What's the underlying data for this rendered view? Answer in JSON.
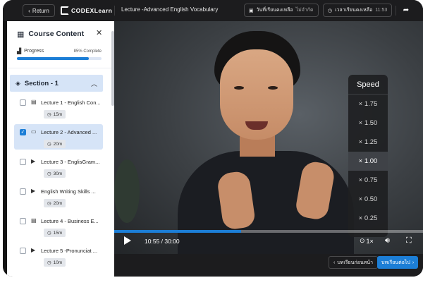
{
  "topbar": {
    "return_label": "Return",
    "logo_text": "CODEXLearn",
    "lecture_title": "Lecture -Advanced English Vocabulary",
    "days_left_label": "วันที่เรียนคงเหลือ",
    "days_left_value": "ไม่จำกัด",
    "time_left_label": "เวลาเรียนคงเหลือ",
    "time_left_value": "11:53"
  },
  "sidebar": {
    "title": "Course Content",
    "progress_label": "Progress",
    "progress_text": "85% Complete",
    "progress_value": 0.85,
    "section_title": "Section - 1",
    "lectures": [
      {
        "title": "Lecture 1 - English Con...",
        "duration": "15m",
        "icon": "document-icon",
        "checked": false,
        "active": false
      },
      {
        "title": "Lecture 2 - Advanced ...",
        "duration": "20m",
        "icon": "folder-icon",
        "checked": true,
        "active": true
      },
      {
        "title": "Lecture 3 - EnglisGram...",
        "duration": "30m",
        "icon": "video-icon",
        "checked": false,
        "active": false
      },
      {
        "title": "English Writing Skills ...",
        "duration": "20m",
        "icon": "video-icon",
        "checked": false,
        "active": false
      },
      {
        "title": "Lecture 4 - Business E...",
        "duration": "15m",
        "icon": "document-icon",
        "checked": false,
        "active": false
      },
      {
        "title": "Lecture 5 -Pronunciat ...",
        "duration": "10m",
        "icon": "video-icon",
        "checked": false,
        "active": false
      }
    ]
  },
  "player": {
    "time_text": "10:55 / 30:00",
    "playback_progress": 0.41,
    "rate_text": "1×",
    "speed_menu_title": "Speed",
    "speed_options": [
      "× 1.75",
      "× 1.50",
      "× 1.25",
      "× 1.00",
      "× 0.75",
      "× 0.50",
      "× 0.25"
    ],
    "selected_speed": "× 1.00"
  },
  "bottombar": {
    "prev_label": "บทเรียนก่อนหน้า",
    "next_label": "บทเรียนต่อไป"
  },
  "colors": {
    "accent": "#1c7ed6",
    "active_row": "#d6e4f7",
    "dark_bg": "#1c1c1e"
  }
}
